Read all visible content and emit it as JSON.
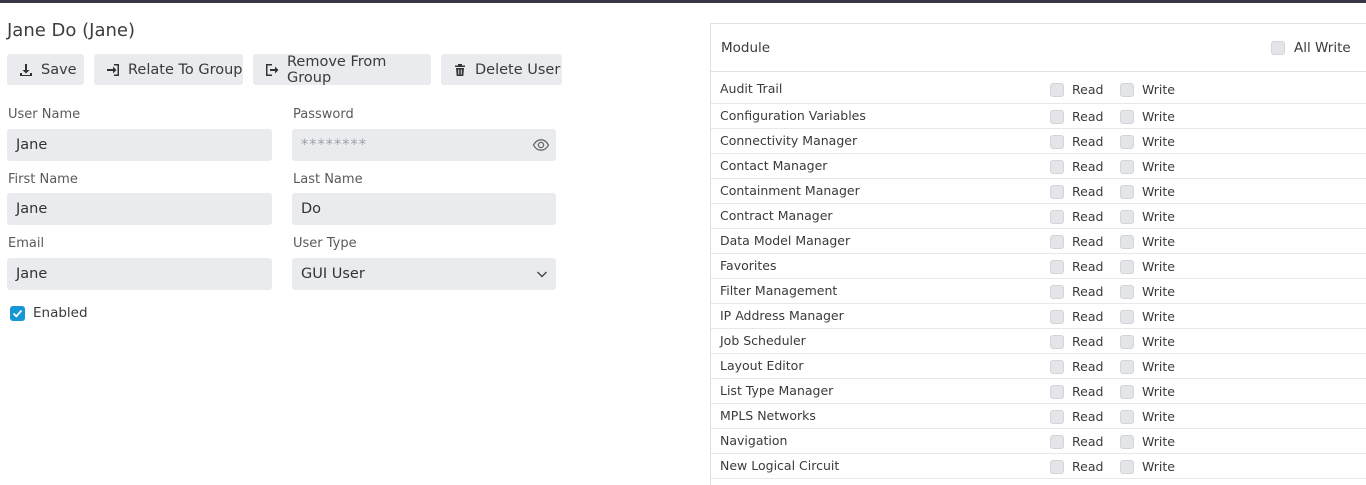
{
  "page": {
    "title": "Jane Do (Jane)"
  },
  "toolbar": {
    "save_label": "Save",
    "relate_label": "Relate To Group",
    "remove_label": "Remove From Group",
    "delete_label": "Delete User"
  },
  "form": {
    "username_label": "User Name",
    "username_value": "Jane",
    "password_label": "Password",
    "password_value": "********",
    "firstname_label": "First Name",
    "firstname_value": "Jane",
    "lastname_label": "Last Name",
    "lastname_value": "Do",
    "email_label": "Email",
    "email_value": "Jane",
    "usertype_label": "User Type",
    "usertype_value": "GUI User",
    "enabled_label": "Enabled",
    "enabled_checked": true
  },
  "permissions": {
    "module_header": "Module",
    "all_write_label": "All Write",
    "read_label": "Read",
    "write_label": "Write",
    "modules": [
      "Audit Trail",
      "Configuration Variables",
      "Connectivity Manager",
      "Contact Manager",
      "Containment Manager",
      "Contract Manager",
      "Data Model Manager",
      "Favorites",
      "Filter Management",
      "IP Address Manager",
      "Job Scheduler",
      "Layout Editor",
      "List Type Manager",
      "MPLS Networks",
      "Navigation",
      "New Logical Circuit"
    ]
  },
  "colors": {
    "accent": "#1597d6",
    "topbar": "#3b3548",
    "field_bg": "#e9ebee"
  },
  "icons": [
    "download-icon",
    "sign-in-icon",
    "sign-out-icon",
    "trash-icon",
    "eye-icon",
    "chevron-down-icon",
    "check-icon"
  ]
}
